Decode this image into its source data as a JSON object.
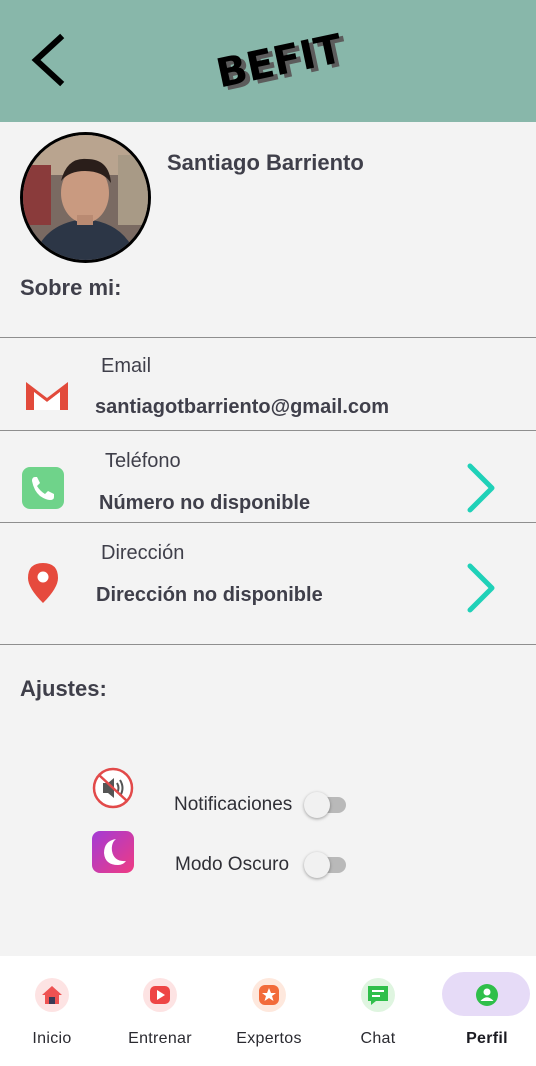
{
  "header": {
    "brand": "BEFIT",
    "back_icon": "arrow-left-icon"
  },
  "profile": {
    "name": "Santiago Barriento",
    "about_title": "Sobre mi:"
  },
  "contact": {
    "email": {
      "label": "Email",
      "value": "santiagotbarriento@gmail.com",
      "icon": "gmail-icon"
    },
    "phone": {
      "label": "Teléfono",
      "value": "Número no disponible",
      "icon": "phone-icon"
    },
    "address": {
      "label": "Dirección",
      "value": "Dirección no disponible",
      "icon": "location-pin-icon"
    }
  },
  "settings": {
    "title": "Ajustes:",
    "notifications": {
      "label": "Notificaciones",
      "enabled": false,
      "icon": "muted-speaker-icon"
    },
    "dark_mode": {
      "label": "Modo Oscuro",
      "enabled": false,
      "icon": "moon-icon"
    }
  },
  "nav": {
    "items": [
      {
        "label": "Inicio",
        "icon": "home-icon",
        "active": false
      },
      {
        "label": "Entrenar",
        "icon": "play-icon",
        "active": false
      },
      {
        "label": "Expertos",
        "icon": "star-icon",
        "active": false
      },
      {
        "label": "Chat",
        "icon": "chat-icon",
        "active": false
      },
      {
        "label": "Perfil",
        "icon": "profile-icon",
        "active": true
      }
    ]
  },
  "colors": {
    "header_bg": "#88b7aa",
    "chevron": "#1fd1b8",
    "nav_active_pill": "#e6dbf7"
  }
}
